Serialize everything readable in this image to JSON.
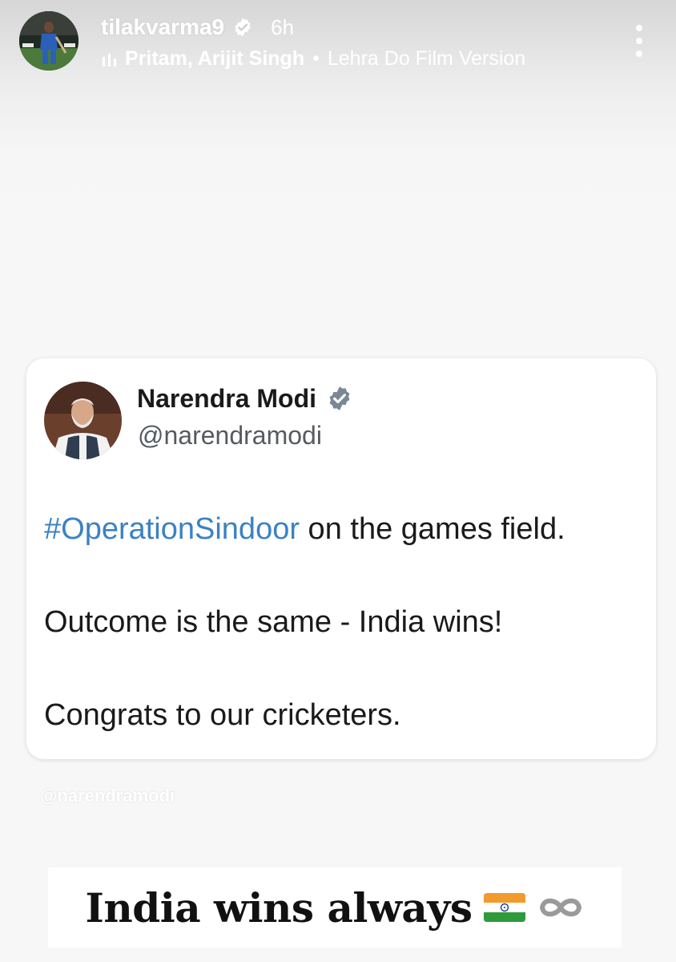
{
  "story": {
    "username": "tilakvarma9",
    "time_ago": "6h",
    "music": {
      "artists": "Pritam, Arijit Singh",
      "separator": "•",
      "song": "Lehra Do Film Version"
    }
  },
  "tweet": {
    "name": "Narendra Modi",
    "handle": "@narendramodi",
    "hashtag": "#OperationSindoor",
    "line1_rest": " on the games field.",
    "line2": "Outcome is the same - India wins!",
    "line3": "Congrats to our cricketers."
  },
  "mention_sticker": "@narendramodi",
  "caption": {
    "text": "India wins always"
  },
  "colors": {
    "hashtag": "#3b82c4",
    "verified_story": "#ffffff",
    "verified_tweet": "#7a8796",
    "tweet_text": "#1a1a1a"
  },
  "icons": {
    "verified": "verified-badge-icon",
    "music": "music-bars-icon",
    "more": "more-vertical-icon",
    "flag": "india-flag-icon",
    "infinity": "infinity-icon"
  }
}
